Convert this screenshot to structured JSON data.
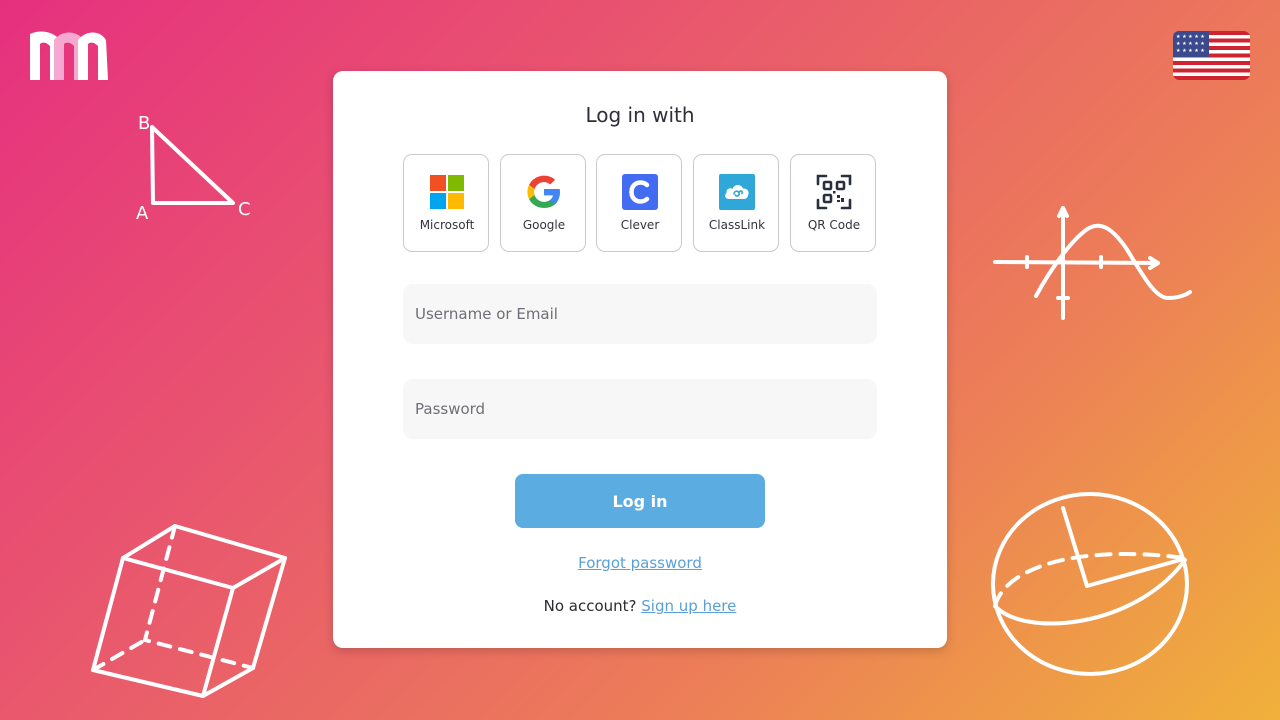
{
  "login": {
    "title": "Log in with",
    "providers": [
      {
        "label": "Microsoft",
        "icon": "microsoft-icon"
      },
      {
        "label": "Google",
        "icon": "google-icon"
      },
      {
        "label": "Clever",
        "icon": "clever-icon"
      },
      {
        "label": "ClassLink",
        "icon": "classlink-icon"
      },
      {
        "label": "QR Code",
        "icon": "qr-code-icon"
      }
    ],
    "username_placeholder": "Username or Email",
    "password_placeholder": "Password",
    "login_label": "Log in",
    "forgot_label": "Forgot password",
    "no_account_text": "No account?",
    "signup_label": "Sign up here"
  },
  "doodles": {
    "triangle_labels": {
      "a": "A",
      "b": "B",
      "c": "C"
    }
  },
  "colors": {
    "gradient_start": "#e6307f",
    "gradient_end": "#f0b13a",
    "login_button": "#5aace1",
    "link": "#5aa0d6"
  },
  "language_flag": "us-flag-icon"
}
